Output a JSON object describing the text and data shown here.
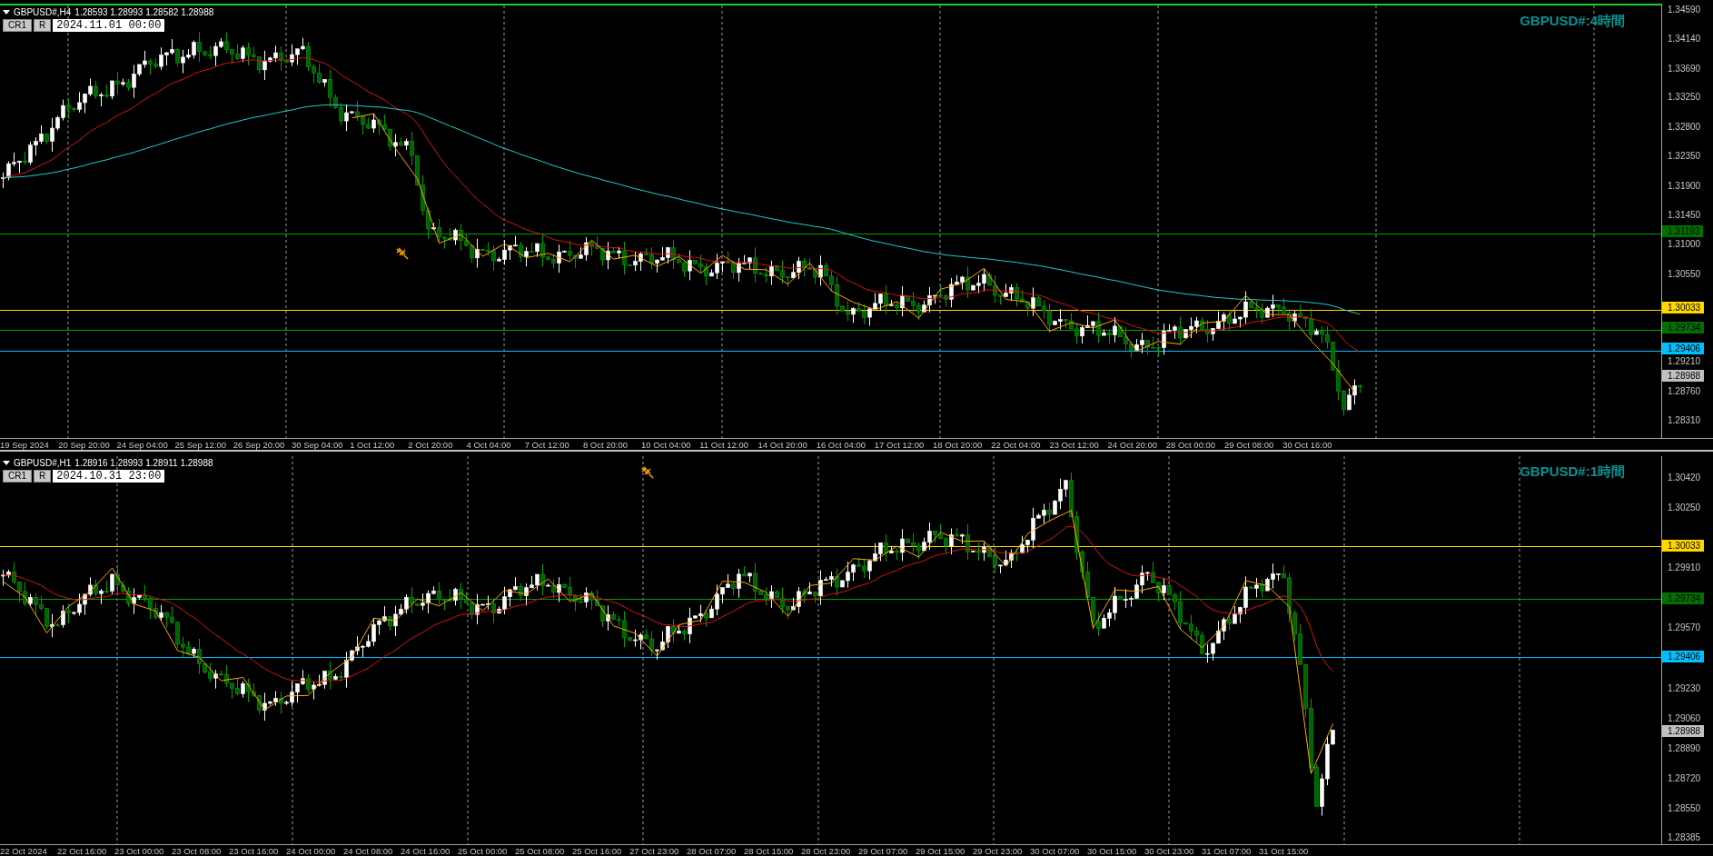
{
  "panes": [
    {
      "symbol": "GBPUSD#,H4",
      "ohlc": "1.28593 1.28993 1.28582 1.28988",
      "buttons": [
        "CR1",
        "R"
      ],
      "datetime": "2024.11.01 00:00",
      "title": "GBPUSD#:4時間",
      "price_ticks": [
        "1.34590",
        "1.34140",
        "1.33690",
        "1.33250",
        "1.32800",
        "1.32350",
        "1.31900",
        "1.31450",
        "1.31000",
        "1.30550",
        "1.29210",
        "1.28760",
        "1.28310"
      ],
      "price_marks": [
        {
          "label": "1.31193",
          "color": "#007000",
          "kind": "line"
        },
        {
          "label": "1.30033",
          "color": "#ffd700",
          "kind": "line"
        },
        {
          "label": "1.29734",
          "color": "#007000",
          "kind": "line"
        },
        {
          "label": "1.29406",
          "color": "#00bfff",
          "kind": "line"
        },
        {
          "label": "1.28988",
          "color": "#c0c0c0",
          "kind": "bid"
        }
      ],
      "time_labels": [
        "19 Sep 2024",
        "20 Sep 20:00",
        "24 Sep 04:00",
        "25 Sep 12:00",
        "26 Sep 20:00",
        "30 Sep 04:00",
        "1 Oct 12:00",
        "2 Oct 20:00",
        "4 Oct 04:00",
        "7 Oct 12:00",
        "8 Oct 20:00",
        "10 Oct 04:00",
        "11 Oct 12:00",
        "14 Oct 20:00",
        "16 Oct 04:00",
        "17 Oct 12:00",
        "18 Oct 20:00",
        "22 Oct 04:00",
        "23 Oct 12:00",
        "24 Oct 20:00",
        "28 Oct 00:00",
        "29 Oct 08:00",
        "30 Oct 16:00"
      ]
    },
    {
      "symbol": "GBPUSD#,H1",
      "ohlc": "1.28916 1.28993 1.28911 1.28988",
      "buttons": [
        "CR1",
        "R"
      ],
      "datetime": "2024.10.31 23:00",
      "title": "GBPUSD#:1時間",
      "price_ticks": [
        "1.30420",
        "1.30250",
        "1.29910",
        "1.29570",
        "1.29230",
        "1.29060",
        "1.28890",
        "1.28720",
        "1.28550",
        "1.28385"
      ],
      "price_marks": [
        {
          "label": "1.30033",
          "color": "#ffd700",
          "kind": "line"
        },
        {
          "label": "1.29734",
          "color": "#007000",
          "kind": "line"
        },
        {
          "label": "1.29406",
          "color": "#00bfff",
          "kind": "line"
        },
        {
          "label": "1.28988",
          "color": "#c0c0c0",
          "kind": "bid"
        }
      ],
      "time_labels": [
        "22 Oct 2024",
        "22 Oct 16:00",
        "23 Oct 00:00",
        "23 Oct 08:00",
        "23 Oct 16:00",
        "24 Oct 00:00",
        "24 Oct 08:00",
        "24 Oct 16:00",
        "25 Oct 00:00",
        "25 Oct 08:00",
        "25 Oct 16:00",
        "27 Oct 23:00",
        "28 Oct 07:00",
        "28 Oct 15:00",
        "28 Oct 23:00",
        "29 Oct 07:00",
        "29 Oct 15:00",
        "29 Oct 23:00",
        "30 Oct 07:00",
        "30 Oct 15:00",
        "30 Oct 23:00",
        "31 Oct 07:00",
        "31 Oct 15:00"
      ]
    }
  ]
}
